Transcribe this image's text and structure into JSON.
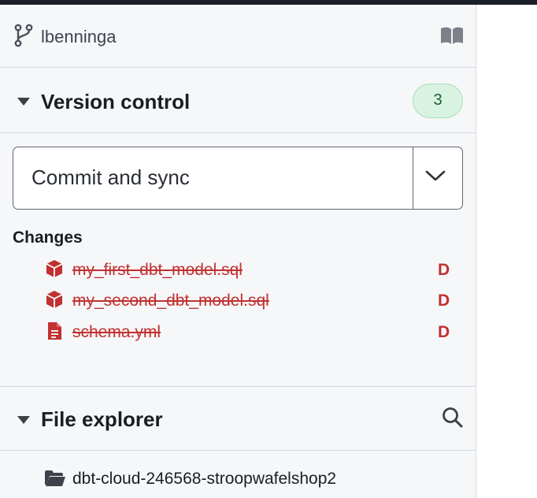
{
  "branch": {
    "icon": "git-branch-icon",
    "name": "lbenninga",
    "docs_icon": "book-icon"
  },
  "version_control": {
    "title": "Version control",
    "count": "3",
    "badge_color": "#d9f3e2",
    "commit_button_label": "Commit and sync",
    "dropdown_icon": "chevron-down-icon"
  },
  "changes": {
    "label": "Changes",
    "files": [
      {
        "name": "my_first_dbt_model.sql",
        "status": "D",
        "icon": "model-cube-icon"
      },
      {
        "name": "my_second_dbt_model.sql",
        "status": "D",
        "icon": "model-cube-icon"
      },
      {
        "name": "schema.yml",
        "status": "D",
        "icon": "file-document-icon"
      }
    ],
    "deleted_color": "#c23030"
  },
  "file_explorer": {
    "title": "File explorer",
    "search_icon": "search-icon",
    "root_folder": "dbt-cloud-246568-stroopwafelshop2",
    "folder_icon": "folder-open-icon"
  }
}
